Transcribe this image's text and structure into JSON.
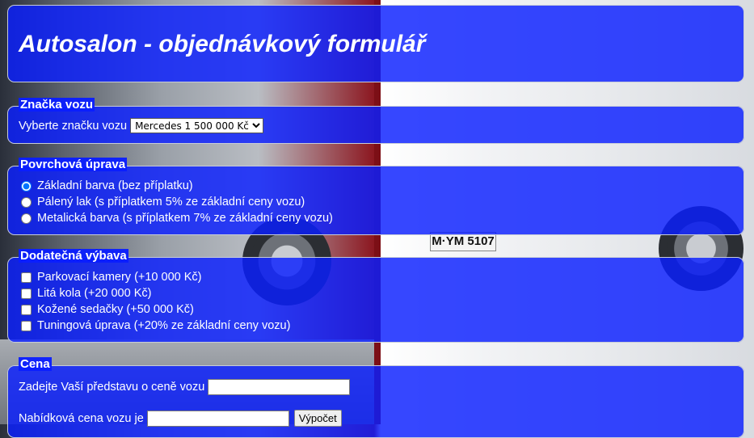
{
  "title": "Autosalon - objednávkový formulář",
  "brand": {
    "legend": "Značka vozu",
    "label": "Vyberte značku vozu",
    "selected": "Mercedes 1 500 000 Kč"
  },
  "surface": {
    "legend": "Povrchová úprava",
    "options": [
      "Základní barva (bez příplatku)",
      "Pálený lak (s příplatkem 5% ze základní ceny vozu)",
      "Metalická barva (s příplatkem 7% ze základní ceny vozu)"
    ]
  },
  "extras": {
    "legend": "Dodatečná výbava",
    "options": [
      "Parkovací kamery (+10 000 Kč)",
      "Litá kola (+20 000 Kč)",
      "Kožené sedačky (+50 000 Kč)",
      "Tuningová úprava (+20% ze základní ceny vozu)"
    ]
  },
  "price": {
    "legend": "Cena",
    "estimate_label": "Zadejte Vaší představu o ceně vozu",
    "offer_label": "Nabídková cena vozu je",
    "calc_button": "Výpočet"
  },
  "background_plate": "M·YM 5107",
  "colors": {
    "panel": "#0a1eff",
    "accent_red": "#8c1720"
  }
}
